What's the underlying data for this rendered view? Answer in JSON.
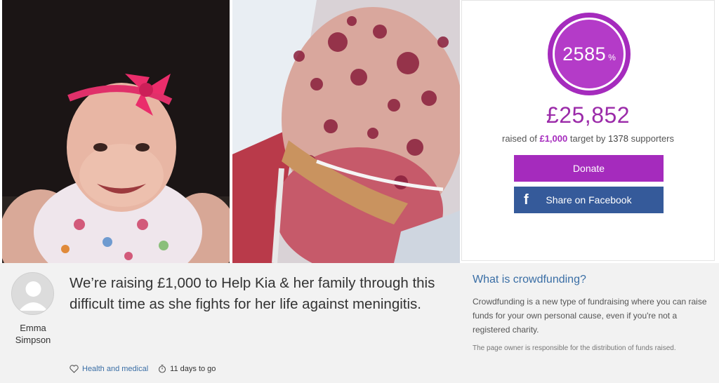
{
  "progress": {
    "percent_value": "2585",
    "percent_sign": "%"
  },
  "raised": {
    "amount": "£25,852",
    "prefix": "raised of ",
    "target": "£1,000",
    "middle": " target by ",
    "supporters": "1378",
    "suffix": " supporters"
  },
  "buttons": {
    "donate": "Donate",
    "share_facebook": "Share on Facebook"
  },
  "owner": {
    "name": "Emma Simpson"
  },
  "campaign": {
    "headline": "We’re raising £1,000 to Help Kia & her family through this difficult time as she fights for her life against meningitis.",
    "category": "Health and medical",
    "time_left": "11 days to go"
  },
  "info": {
    "title": "What is crowdfunding?",
    "body": "Crowdfunding is a new type of fundraising where you can raise funds for your own personal cause, even if you're not a registered charity.",
    "note": "The page owner is responsible for the distribution of funds raised."
  },
  "icons": {
    "heart": "heart-icon",
    "stopwatch": "stopwatch-icon",
    "facebook": "facebook-icon"
  },
  "colors": {
    "accent": "#a52bbd",
    "facebook": "#355a9a",
    "link": "#3a6ea5"
  }
}
